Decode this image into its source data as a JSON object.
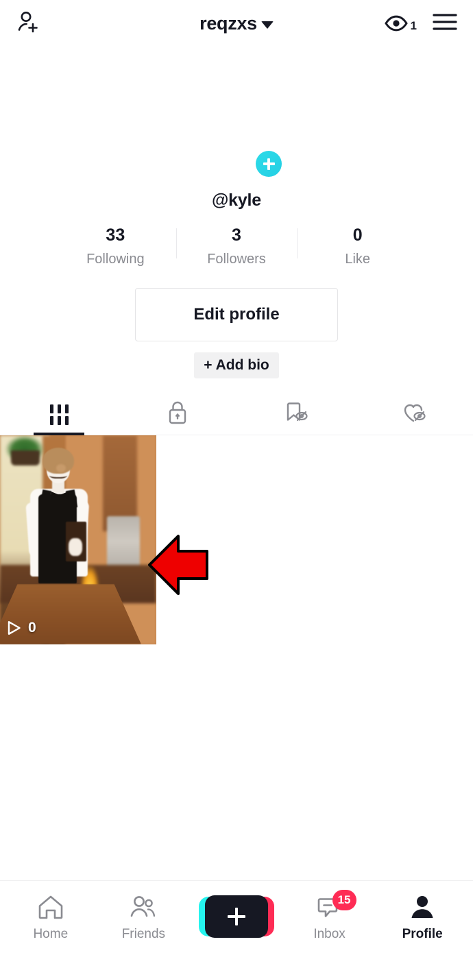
{
  "header": {
    "title": "reqzxs",
    "add_friend_icon": "person-add-icon",
    "dropdown_icon": "chevron-down-icon",
    "views_icon": "eye-icon",
    "views_count": "1",
    "menu_icon": "hamburger-menu-icon"
  },
  "profile": {
    "avatar_add_icon": "plus-icon",
    "handle": "@kyle",
    "stats": [
      {
        "value": "33",
        "label": "Following"
      },
      {
        "value": "3",
        "label": "Followers"
      },
      {
        "value": "0",
        "label": "Like"
      }
    ],
    "edit_profile_label": "Edit profile",
    "add_bio_label": "+ Add bio"
  },
  "tabs": [
    {
      "name": "posts",
      "icon": "grid-icon",
      "active": true
    },
    {
      "name": "private",
      "icon": "lock-icon",
      "active": false
    },
    {
      "name": "saved",
      "icon": "bookmark-hidden-icon",
      "active": false
    },
    {
      "name": "liked",
      "icon": "heart-hidden-icon",
      "active": false
    }
  ],
  "videos": [
    {
      "play_icon": "play-icon",
      "play_count": "0",
      "description": "animated waiter character in black apron and bow tie standing behind a wooden table"
    }
  ],
  "annotation": {
    "arrow_icon": "left-arrow-annotation",
    "fill": "#ee0000",
    "stroke": "#000000"
  },
  "bottom_nav": [
    {
      "label": "Home",
      "icon": "home-icon",
      "active": false
    },
    {
      "label": "Friends",
      "icon": "friends-icon",
      "active": false
    },
    {
      "label": "",
      "icon": "create-plus-icon",
      "active": false
    },
    {
      "label": "Inbox",
      "icon": "inbox-icon",
      "badge": "15",
      "active": false
    },
    {
      "label": "Profile",
      "icon": "profile-person-icon",
      "active": true
    }
  ],
  "colors": {
    "accent_cyan": "#25f4ee",
    "accent_pink": "#fe2c55",
    "text_primary": "#161823",
    "text_secondary": "#8a8b91"
  }
}
